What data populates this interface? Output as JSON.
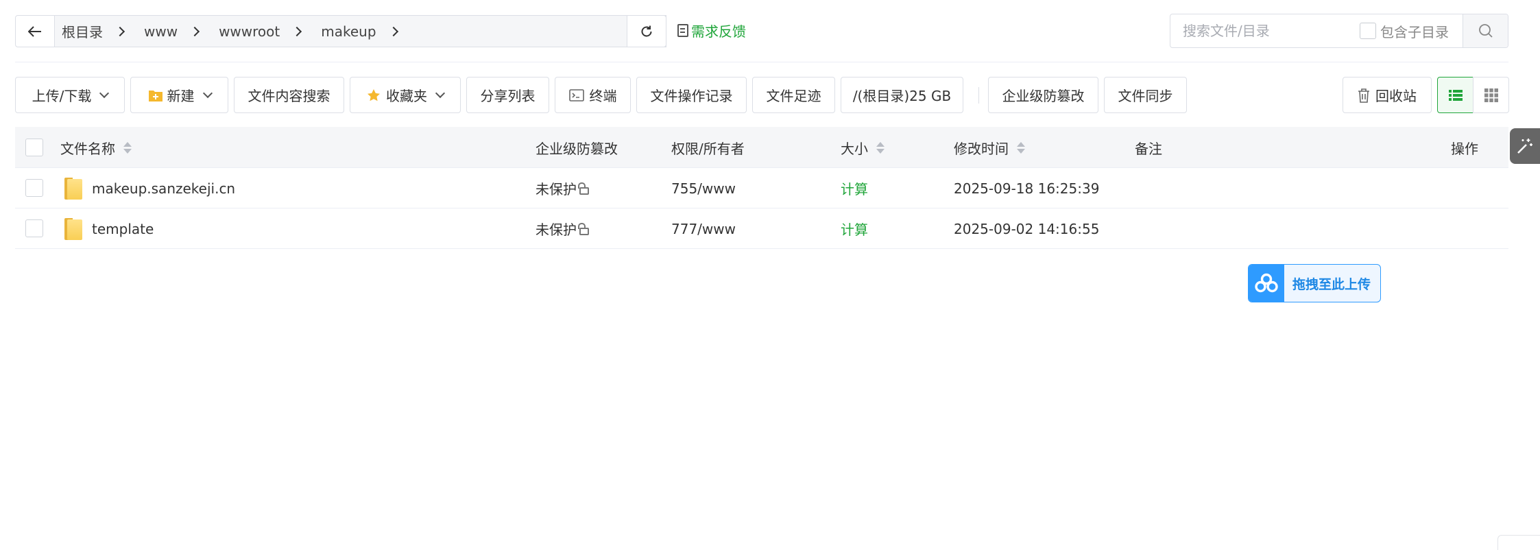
{
  "path": {
    "crumbs": [
      "根目录",
      "www",
      "wwwroot",
      "makeup"
    ],
    "feedback": "需求反馈"
  },
  "search": {
    "placeholder": "搜索文件/目录",
    "subdir_label": "包含子目录"
  },
  "toolbar": {
    "upload": "上传/下载",
    "new": "新建",
    "content_search": "文件内容搜索",
    "favorites": "收藏夹",
    "share_list": "分享列表",
    "terminal": "终端",
    "op_log": "文件操作记录",
    "footprint": "文件足迹",
    "disk": "/(根目录)25 GB",
    "tamper": "企业级防篡改",
    "sync": "文件同步",
    "recycle": "回收站"
  },
  "table": {
    "headers": {
      "name": "文件名称",
      "tamper": "企业级防篡改",
      "perm": "权限/所有者",
      "size": "大小",
      "mtime": "修改时间",
      "note": "备注",
      "ops": "操作"
    },
    "rows": [
      {
        "name": "makeup.sanzekeji.cn",
        "tamper": "未保护",
        "perm": "755/www",
        "size": "计算",
        "mtime": "2025-09-18 16:25:39",
        "note": ""
      },
      {
        "name": "template",
        "tamper": "未保护",
        "perm": "777/www",
        "size": "计算",
        "mtime": "2025-09-02 14:16:55",
        "note": ""
      }
    ]
  },
  "upload_drop": {
    "label": "拖拽至此上传"
  },
  "colors": {
    "accent": "#20a53a",
    "upload_blue": "#2e9bff",
    "folder": "#f9cf55"
  }
}
